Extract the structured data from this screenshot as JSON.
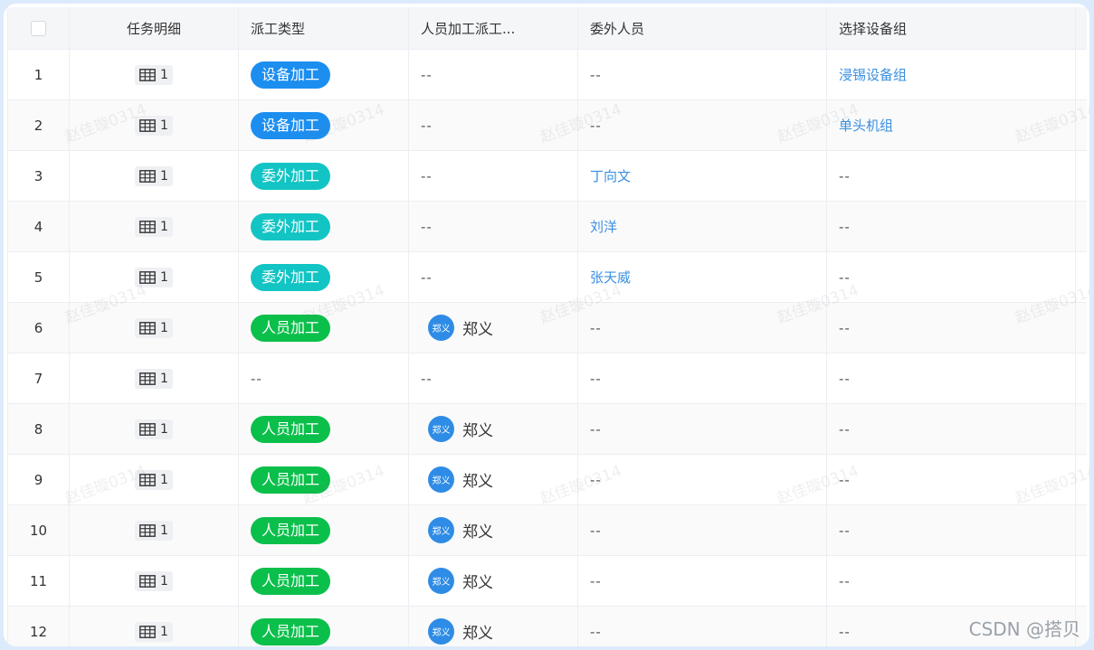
{
  "header": {
    "task_detail": "任务明细",
    "dispatch_type": "派工类型",
    "person_dispatch": "人员加工派工...",
    "outsource_person": "委外人员",
    "device_group": "选择设备组"
  },
  "colors": {
    "device": "#1c8ef0",
    "outsource": "#12c4c4",
    "person": "#0bbf4b",
    "link": "#3b8fe0"
  },
  "icons": {
    "task": "table-grid-icon",
    "checkbox": "checkbox-icon"
  },
  "rows": [
    {
      "index": "1",
      "task_count": "1",
      "type": "设备加工",
      "type_color": "#1c8ef0",
      "person_avatar": "",
      "person_name": "",
      "person_text": "--",
      "outsource": "--",
      "outsource_link": false,
      "group": "浸锡设备组",
      "group_link": true
    },
    {
      "index": "2",
      "task_count": "1",
      "type": "设备加工",
      "type_color": "#1c8ef0",
      "person_avatar": "",
      "person_name": "",
      "person_text": "--",
      "outsource": "--",
      "outsource_link": false,
      "group": "单头机组",
      "group_link": true
    },
    {
      "index": "3",
      "task_count": "1",
      "type": "委外加工",
      "type_color": "#12c4c4",
      "person_avatar": "",
      "person_name": "",
      "person_text": "--",
      "outsource": "丁向文",
      "outsource_link": true,
      "group": "--",
      "group_link": false
    },
    {
      "index": "4",
      "task_count": "1",
      "type": "委外加工",
      "type_color": "#12c4c4",
      "person_avatar": "",
      "person_name": "",
      "person_text": "--",
      "outsource": "刘洋",
      "outsource_link": true,
      "group": "--",
      "group_link": false
    },
    {
      "index": "5",
      "task_count": "1",
      "type": "委外加工",
      "type_color": "#12c4c4",
      "person_avatar": "",
      "person_name": "",
      "person_text": "--",
      "outsource": "张天威",
      "outsource_link": true,
      "group": "--",
      "group_link": false
    },
    {
      "index": "6",
      "task_count": "1",
      "type": "人员加工",
      "type_color": "#0bbf4b",
      "person_avatar": "郑义",
      "person_name": "郑义",
      "person_text": "",
      "outsource": "--",
      "outsource_link": false,
      "group": "--",
      "group_link": false
    },
    {
      "index": "7",
      "task_count": "1",
      "type": "",
      "type_color": "",
      "type_text": "--",
      "person_avatar": "",
      "person_name": "",
      "person_text": "--",
      "outsource": "--",
      "outsource_link": false,
      "group": "--",
      "group_link": false
    },
    {
      "index": "8",
      "task_count": "1",
      "type": "人员加工",
      "type_color": "#0bbf4b",
      "person_avatar": "郑义",
      "person_name": "郑义",
      "person_text": "",
      "outsource": "--",
      "outsource_link": false,
      "group": "--",
      "group_link": false
    },
    {
      "index": "9",
      "task_count": "1",
      "type": "人员加工",
      "type_color": "#0bbf4b",
      "person_avatar": "郑义",
      "person_name": "郑义",
      "person_text": "",
      "outsource": "--",
      "outsource_link": false,
      "group": "--",
      "group_link": false
    },
    {
      "index": "10",
      "task_count": "1",
      "type": "人员加工",
      "type_color": "#0bbf4b",
      "person_avatar": "郑义",
      "person_name": "郑义",
      "person_text": "",
      "outsource": "--",
      "outsource_link": false,
      "group": "--",
      "group_link": false
    },
    {
      "index": "11",
      "task_count": "1",
      "type": "人员加工",
      "type_color": "#0bbf4b",
      "person_avatar": "郑义",
      "person_name": "郑义",
      "person_text": "",
      "outsource": "--",
      "outsource_link": false,
      "group": "--",
      "group_link": false
    },
    {
      "index": "12",
      "task_count": "1",
      "type": "人员加工",
      "type_color": "#0bbf4b",
      "person_avatar": "郑义",
      "person_name": "郑义",
      "person_text": "",
      "outsource": "--",
      "outsource_link": false,
      "group": "--",
      "group_link": false
    }
  ],
  "watermark_text": "赵佳璇0314",
  "csdn_mark": "CSDN @搭贝"
}
